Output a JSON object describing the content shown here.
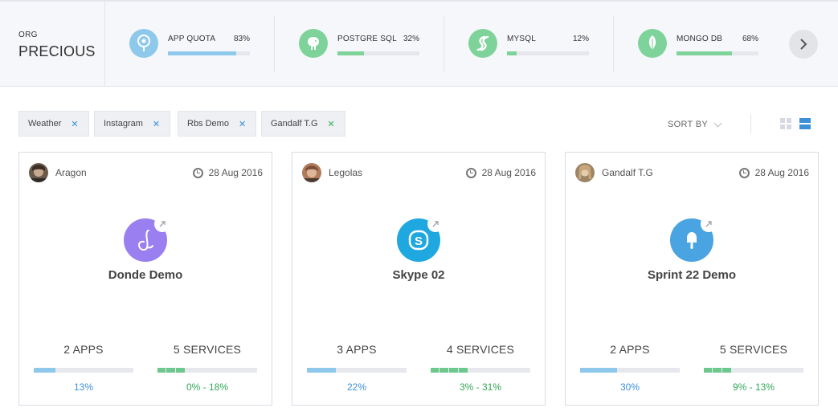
{
  "org": {
    "label": "ORG",
    "name": "PRECIOUS"
  },
  "quotas": [
    {
      "name": "APP QUOTA",
      "percent": "83%",
      "fraction": 0.83,
      "color": "#8ec9ec",
      "icon": "pin-icon"
    },
    {
      "name": "POSTGRE SQL",
      "percent": "32%",
      "fraction": 0.32,
      "color": "#7ed39a",
      "icon": "elephant-icon"
    },
    {
      "name": "MYSQL",
      "percent": "12%",
      "fraction": 0.12,
      "color": "#7ed39a",
      "icon": "swirl-icon"
    },
    {
      "name": "MONGO DB",
      "percent": "68%",
      "fraction": 0.68,
      "color": "#7ed39a",
      "icon": "leaf-icon"
    }
  ],
  "filters": [
    {
      "label": "Weather"
    },
    {
      "label": "Instagram"
    },
    {
      "label": "Rbs Demo"
    },
    {
      "label": "Gandalf T.G"
    }
  ],
  "sort": {
    "label": "SORT BY"
  },
  "cards": [
    {
      "owner": "Aragon",
      "date": "28 Aug 2016",
      "name": "Donde Demo",
      "icon": "script-d-icon",
      "icon_color": "#9a7ff0",
      "apps": "2 APPS",
      "apps_pct": "13%",
      "apps_fraction": 0.22,
      "services": "5 SERVICES",
      "services_pct": "0% - 18%",
      "services_segments": 3
    },
    {
      "owner": "Legolas",
      "date": "28 Aug 2016",
      "name": "Skype 02",
      "icon": "skype-icon",
      "icon_color": "#1fa7e0",
      "apps": "3 APPS",
      "apps_pct": "22%",
      "apps_fraction": 0.29,
      "services": "4 SERVICES",
      "services_pct": "3% - 31%",
      "services_segments": 4
    },
    {
      "owner": "Gandalf T.G",
      "date": "28 Aug 2016",
      "name": "Sprint 22 Demo",
      "icon": "popsicle-icon",
      "icon_color": "#4ba4e2",
      "apps": "2 APPS",
      "apps_pct": "30%",
      "apps_fraction": 0.37,
      "services": "5 SERVICES",
      "services_pct": "9% - 13%",
      "services_segments": 3
    }
  ],
  "colors": {
    "accent_blue": "#3b90d8",
    "accent_green": "#33b25e",
    "bar_blue": "#8ec9ec",
    "bar_green": "#6dc88d"
  }
}
